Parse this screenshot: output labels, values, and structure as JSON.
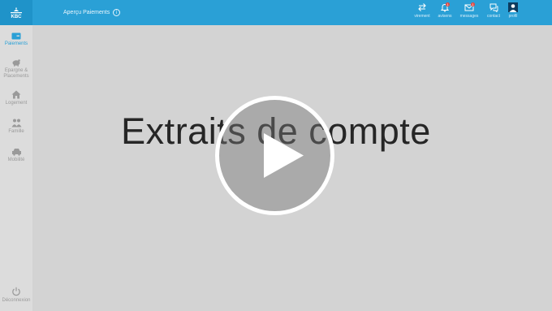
{
  "header": {
    "breadcrumb": "Aperçu Paiements",
    "info_icon": "i",
    "nav": [
      {
        "label": "virement",
        "icon": "transfer-icon"
      },
      {
        "label": "avisens",
        "icon": "bell-icon",
        "badge": "1"
      },
      {
        "label": "messages",
        "icon": "mail-icon",
        "badge": "1"
      },
      {
        "label": "contact",
        "icon": "chat-icon"
      },
      {
        "label": "profil",
        "icon": "user-icon"
      }
    ]
  },
  "sidebar": {
    "items": [
      {
        "label": "Paiements",
        "icon": "card-icon",
        "active": true
      },
      {
        "label": "Epargne &\nPlacements",
        "icon": "piggy-bank-icon"
      },
      {
        "label": "Logement",
        "icon": "house-icon"
      },
      {
        "label": "Famille",
        "icon": "family-icon"
      },
      {
        "label": "Mobilité",
        "icon": "car-icon"
      }
    ],
    "logout": {
      "label": "Déconnexion",
      "icon": "power-icon"
    }
  },
  "video": {
    "title": "Extraits de compte",
    "play_icon": "play-icon"
  },
  "colors": {
    "topbar": "#2aa0d6",
    "sidebar_bg": "#dcdcdc",
    "main_bg": "#d3d3d3",
    "active": "#2aa0d6",
    "badge": "#e2473f"
  }
}
